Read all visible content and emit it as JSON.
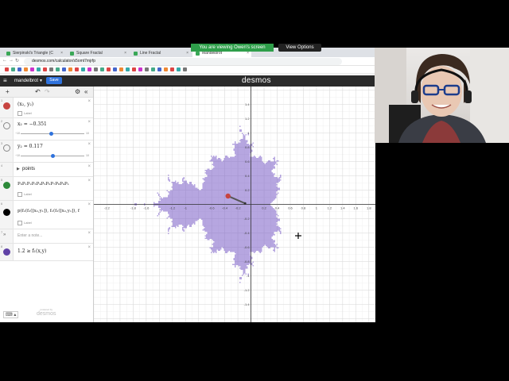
{
  "share_banner": {
    "text": "You are viewing Owen's screen",
    "view_options": "View Options"
  },
  "browser": {
    "tabs": [
      {
        "label": "Sierpinski's Triangle (C"
      },
      {
        "label": "Square Fractal"
      },
      {
        "label": "Line Fractal"
      },
      {
        "label": "Mandelbrot"
      }
    ],
    "url": "desmos.com/calculator/s5omt7mjrfp"
  },
  "desmos": {
    "graph_title": "mandelbrot",
    "save_label": "Save",
    "logo": "desmos",
    "powered_by": "powered by",
    "powered_logo": "desmos",
    "expressions": [
      {
        "n": "1",
        "text": "(x₂, y₂)",
        "label": "Label",
        "color": "#c74440"
      },
      {
        "n": "2",
        "text": "x₂ = −0.351",
        "slider_min": "−10",
        "slider_max": "10",
        "value_frac": 0.482
      },
      {
        "n": "3",
        "text": "y₂ = 0.117",
        "slider_min": "−10",
        "slider_max": "10",
        "value_frac": 0.506
      },
      {
        "n": "4",
        "text": "points"
      },
      {
        "n": "5",
        "text": "P₀P₁P₂P₃P₄P₅P₆P₇P₈P₉P₁",
        "label": "Label",
        "color": "#2d8a3a"
      },
      {
        "n": "6",
        "text": "p(f₁(f₂([x₂,y₁]), f₁(f₂([x₂,y₁]), f",
        "label": "Label",
        "color": "#000000"
      },
      {
        "n": "7",
        "text": "Enter a note..."
      },
      {
        "n": "8",
        "text": "1.2 ≥ f₁(x,y)",
        "color": "#6042a6"
      }
    ]
  },
  "chart_data": {
    "type": "scatter",
    "title": "",
    "xlim": [
      -2.4,
      1.9
    ],
    "ylim": [
      -1.65,
      1.65
    ],
    "x_ticks": [
      "-2.2",
      "-1.8",
      "-1.6",
      "-1.2",
      "-1",
      "-0.6",
      "-0.4",
      "-0.2",
      "0.2",
      "0.4",
      "0.6",
      "0.8",
      "1",
      "1.2",
      "1.4",
      "1.6",
      "1.8"
    ],
    "y_ticks": [
      "1.4",
      "1.2",
      "1",
      "0.8",
      "0.6",
      "0.4",
      "0.2",
      "-0.2",
      "-0.4",
      "-0.6",
      "-0.8",
      "-1",
      "-1.2",
      "-1.4"
    ],
    "region": {
      "name": "1.2 ≥ f₁(x,y)",
      "color": "#7a5cc6"
    },
    "point": {
      "x": -0.351,
      "y": 0.117,
      "color": "#c74440"
    },
    "orbit": {
      "from": [
        -0.351,
        0.117
      ],
      "to": [
        -0.09,
        0.014
      ],
      "color": "#555555"
    },
    "grid": true
  }
}
